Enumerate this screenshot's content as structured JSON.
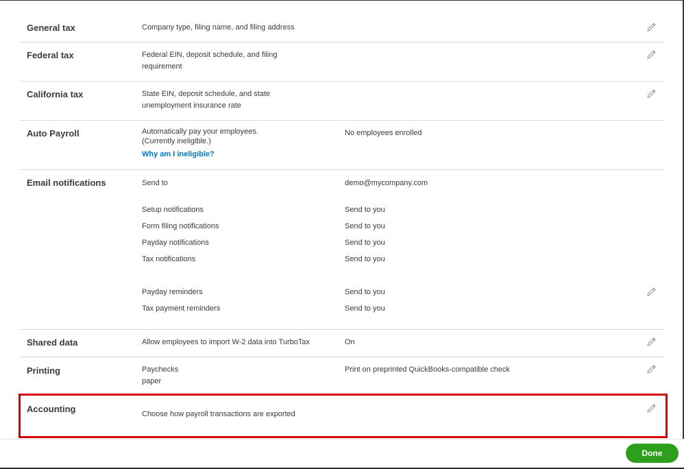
{
  "sections": {
    "general_tax": {
      "title": "General tax",
      "desc": [
        "Company type, filing name, and filing address"
      ]
    },
    "federal_tax": {
      "title": "Federal tax",
      "desc": [
        "Federal EIN, deposit schedule, and filing",
        "requirement"
      ]
    },
    "california_tax": {
      "title": "California tax",
      "desc": [
        "State EIN, deposit schedule, and state",
        "unemployment insurance rate"
      ]
    },
    "auto_payroll": {
      "title": "Auto Payroll",
      "desc": [
        "Automatically pay your employees.",
        "(Currently ineligible.)"
      ],
      "link": "Why am I ineligible?",
      "value": "No employees enrolled"
    },
    "email_notifications": {
      "title": "Email notifications",
      "rows": [
        {
          "label": "Send to",
          "value": "demo@mycompany.com"
        },
        {
          "label": "Setup notifications",
          "value": "Send to you"
        },
        {
          "label": "Form filing notifications",
          "value": "Send to you"
        },
        {
          "label": "Payday notifications",
          "value": "Send to you"
        },
        {
          "label": "Tax notifications",
          "value": "Send to you"
        },
        {
          "label": "Payday reminders",
          "value": "Send to you"
        },
        {
          "label": "Tax payment reminders",
          "value": "Send to you"
        }
      ]
    },
    "shared_data": {
      "title": "Shared data",
      "desc": [
        "Allow employees to import W-2 data into TurboTax"
      ],
      "value": "On"
    },
    "printing": {
      "title": "Printing",
      "desc": [
        "Paychecks",
        "paper"
      ],
      "value": "Print on preprinted QuickBooks-compatible check"
    },
    "accounting": {
      "title": "Accounting",
      "desc": [
        "Choose how payroll transactions are exported"
      ]
    }
  },
  "footer": {
    "done_label": "Done"
  },
  "colors": {
    "accent_link": "#0077c5",
    "done_button": "#2ca01c",
    "highlight_border": "#d60000"
  },
  "icons": {
    "edit": "pencil-icon"
  }
}
